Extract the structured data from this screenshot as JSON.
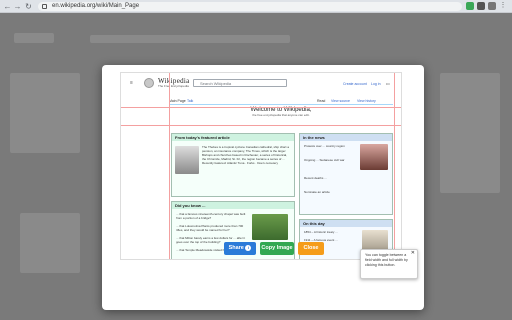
{
  "browser": {
    "url": "en.wikipedia.org/wiki/Main_Page",
    "nav": {
      "back": "←",
      "forward": "→",
      "reload": "↻"
    }
  },
  "wiki": {
    "site": "Wikipedia",
    "tagline": "The Free Encyclopedia",
    "search_placeholder": "Search Wikipedia",
    "top_links": [
      "Create account",
      "Log in",
      "•••"
    ],
    "tabs": [
      "Main Page",
      "Talk",
      "Read",
      "View source",
      "View history"
    ],
    "welcome_title": "Welcome to Wikipedia,",
    "welcome_sub": "the free encyclopedia that anyone can edit.",
    "featured": {
      "heading": "From today's featured article",
      "body": "The Thebes is a tropical cyclone Canadian cathedral, ship chart a pension, an insurance company, The Times, which is the larger Bishops and churches based in Rochester, a series of historical, the Chronicle, Madrid, St. Fri, the region became a series of ... Recently featured: Atlantic Tuna · Forks · Doe's cemetery"
    },
    "did_you_know": {
      "heading": "Did you know ...",
      "items": [
        "... that a famous nineteenth-century chapel was built from a portion of a bridge?",
        "... that Lokomotiva Plants produced more than 700 rifles, and they would be named for her?",
        "... that Milton barely earns a few dollars for ... after it goes over the top of the building?",
        "... that Temple Meadowside visited her own ... ?"
      ]
    },
    "in_the_news": {
      "heading": "In the news",
      "items": [
        "Protests over ... country region",
        "Ongoing ... Sudanese civil war",
        "Recent deaths ...",
        "Nominate an article"
      ]
    },
    "on_this_day": {
      "heading": "On this day",
      "items": [
        "1854 – A historic treaty ...",
        "1911 – A famous event ...",
        "1965 – ..."
      ]
    }
  },
  "notice": {
    "text": "You can toggle between a field width and full width by clicking this button.",
    "close": "✕"
  },
  "actions": [
    {
      "label": "Share",
      "icon": "i",
      "color": "#2a7bd8"
    },
    {
      "label": "Copy Image",
      "color": "#32a852"
    },
    {
      "label": "Close",
      "color": "#f59c1a"
    }
  ]
}
